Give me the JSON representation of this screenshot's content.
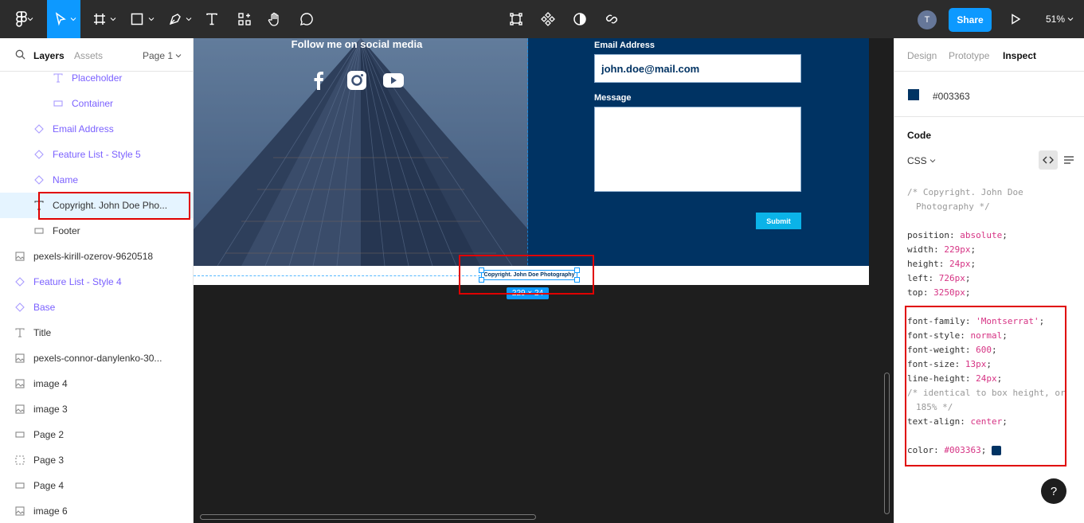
{
  "toolbar": {
    "share_label": "Share",
    "avatar_initial": "T",
    "zoom": "51%"
  },
  "left_panel": {
    "tabs": {
      "layers": "Layers",
      "assets": "Assets",
      "page": "Page 1"
    },
    "layers": [
      {
        "label": "Placeholder",
        "icon": "text-icon"
      },
      {
        "label": "Container",
        "icon": "rectangle-icon"
      },
      {
        "label": "Email Address",
        "icon": "component-instance-icon"
      },
      {
        "label": "Feature List - Style 5",
        "icon": "component-instance-icon"
      },
      {
        "label": "Name",
        "icon": "component-instance-icon"
      },
      {
        "label": "Copyright. John Doe Pho...",
        "icon": "text-icon"
      },
      {
        "label": "Footer",
        "icon": "rectangle-icon"
      },
      {
        "label": "pexels-kirill-ozerov-9620518",
        "icon": "image-icon"
      },
      {
        "label": "Feature List - Style 4",
        "icon": "component-instance-icon"
      },
      {
        "label": "Base",
        "icon": "component-instance-icon"
      },
      {
        "label": "Title",
        "icon": "text-icon"
      },
      {
        "label": "pexels-connor-danylenko-30...",
        "icon": "image-icon"
      },
      {
        "label": "image 4",
        "icon": "image-icon"
      },
      {
        "label": "image 3",
        "icon": "image-icon"
      },
      {
        "label": "Page 2",
        "icon": "rectangle-icon"
      },
      {
        "label": "Page 3",
        "icon": "dashed-frame-icon"
      },
      {
        "label": "Page 4",
        "icon": "rectangle-icon"
      },
      {
        "label": "image 6",
        "icon": "image-icon"
      }
    ]
  },
  "canvas": {
    "social_heading": "Follow me on social media",
    "email_label": "Email Address",
    "email_value": "john.doe@mail.com",
    "message_label": "Message",
    "submit_label": "Submit",
    "footer_text": "Copyright. John Doe Photography",
    "size_badge": "229 × 24",
    "colors": {
      "form_bg": "#003363",
      "submit_bg": "#0bb3e8",
      "selection": "#0d99ff"
    }
  },
  "right_panel": {
    "tabs": {
      "design": "Design",
      "prototype": "Prototype",
      "inspect": "Inspect"
    },
    "color_hex": "#003363",
    "code_heading": "Code",
    "language": "CSS",
    "comment1": "/* Copyright. John Doe",
    "comment2": "Photography */",
    "props": [
      {
        "k": "position",
        "v": "absolute"
      },
      {
        "k": "width",
        "v": "229px"
      },
      {
        "k": "height",
        "v": "24px"
      },
      {
        "k": "left",
        "v": "726px"
      },
      {
        "k": "top",
        "v": "3250px"
      }
    ],
    "font_props": [
      {
        "k": "font-family",
        "v": "'Montserrat'"
      },
      {
        "k": "font-style",
        "v": "normal"
      },
      {
        "k": "font-weight",
        "v": "600"
      },
      {
        "k": "font-size",
        "v": "13px"
      },
      {
        "k": "line-height",
        "v": "24px"
      }
    ],
    "comment3": "/* identical to box height, or",
    "comment4": "185% */",
    "text_align": {
      "k": "text-align",
      "v": "center"
    },
    "color_prop": {
      "k": "color",
      "v": "#003363"
    },
    "help": "?"
  }
}
